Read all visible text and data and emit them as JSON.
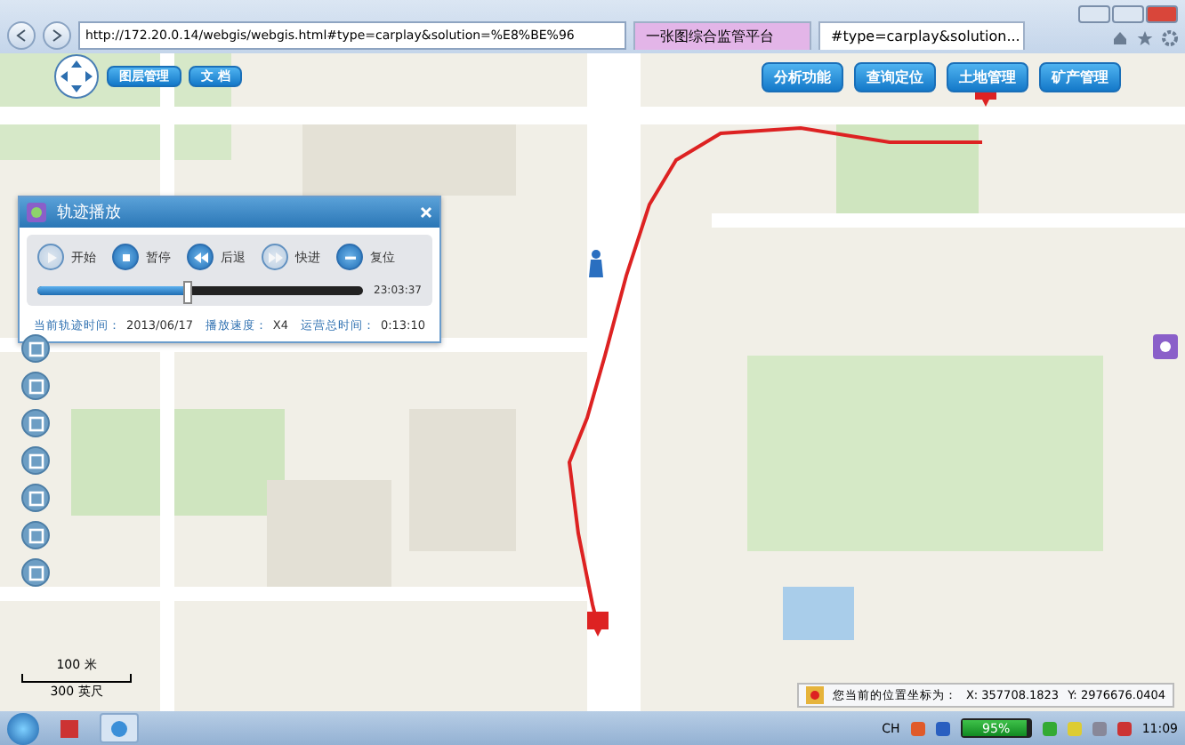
{
  "browser": {
    "address": "http://172.20.0.14/webgis/webgis.html#type=carplay&solution=%E8%BE%96",
    "tabs": [
      {
        "label": "一张图综合监管平台",
        "selected": false
      },
      {
        "label": "#type=carplay&solution...",
        "selected": true
      }
    ]
  },
  "map_toolbar": {
    "left_buttons": [
      "图层管理",
      "文 档"
    ],
    "right_buttons": [
      "分析功能",
      "查询定位",
      "土地管理",
      "矿产管理"
    ]
  },
  "player": {
    "title": "轨迹播放",
    "controls": [
      {
        "kind": "play",
        "label": "开始",
        "disabled": true
      },
      {
        "kind": "pause",
        "label": "暂停",
        "disabled": false
      },
      {
        "kind": "rewind",
        "label": "后退",
        "disabled": false
      },
      {
        "kind": "forward",
        "label": "快进",
        "disabled": true
      },
      {
        "kind": "reset",
        "label": "复位",
        "disabled": false
      }
    ],
    "progress": {
      "level": 0.46,
      "time": "23:03:37"
    },
    "info": [
      {
        "label": "当前轨迹时间：",
        "value": "2013/06/17"
      },
      {
        "label": "播放速度：",
        "value": "X4"
      },
      {
        "label": "运营总时间：",
        "value": "0:13:10"
      }
    ]
  },
  "scale": {
    "metric": "100 米",
    "imperial": "300 英尺"
  },
  "position": {
    "label": "您当前的位置坐标为：",
    "x": "X: 357708.1823",
    "y": "Y: 2976676.0404"
  },
  "taskbar": {
    "language": "CH",
    "battery": {
      "level": 0.95,
      "text": "95%"
    },
    "clock": "11:09"
  }
}
